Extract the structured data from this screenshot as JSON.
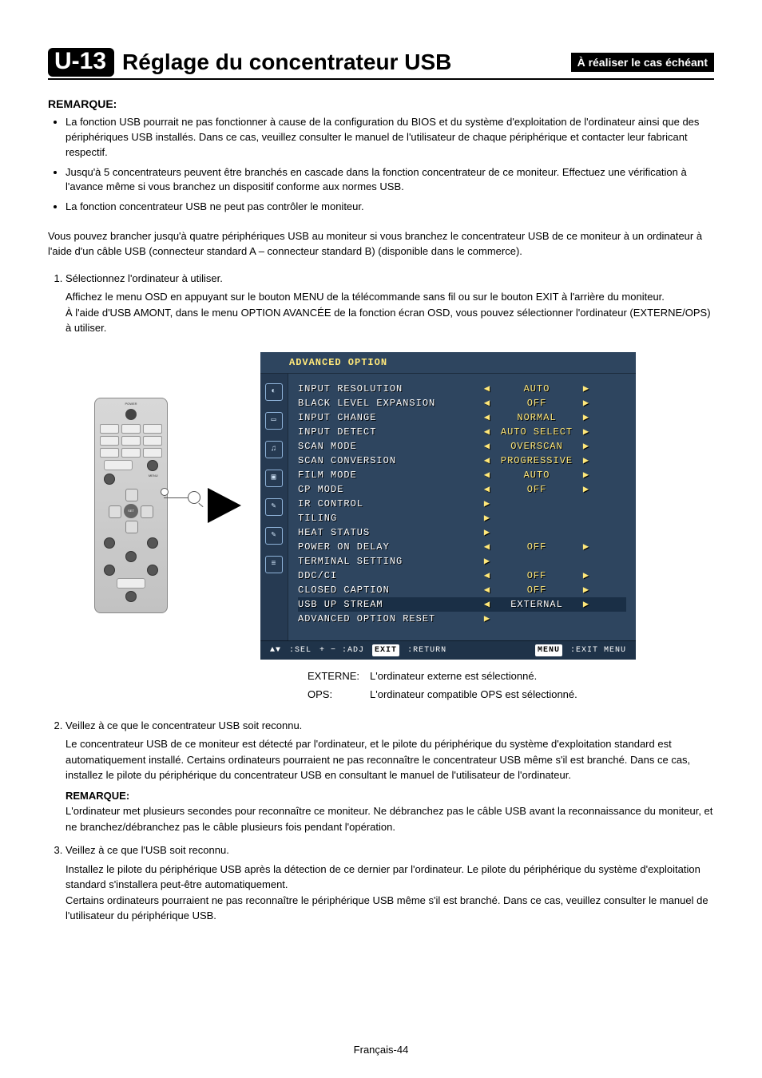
{
  "header": {
    "tag": "U-13",
    "title": "Réglage du concentrateur USB",
    "badge": "À réaliser le cas échéant"
  },
  "remarque_label": "REMARQUE:",
  "remarque_bullets": [
    "La fonction USB pourrait ne pas fonctionner à cause de la configuration du BIOS et du système d'exploitation de l'ordinateur ainsi que des périphériques USB installés. Dans ce cas, veuillez consulter le manuel de l'utilisateur de chaque périphérique et contacter leur fabricant respectif.",
    "Jusqu'à 5 concentrateurs peuvent être branchés en cascade dans la fonction concentrateur de ce moniteur. Effectuez une vérification à l'avance même si vous branchez un dispositif conforme aux normes USB.",
    "La fonction concentrateur USB ne peut pas contrôler le moniteur."
  ],
  "intro": "Vous pouvez brancher jusqu'à quatre périphériques USB au moniteur si vous branchez le concentrateur USB de ce moniteur à un ordinateur à l'aide d'un câble USB (connecteur standard A – connecteur standard B) (disponible dans le commerce).",
  "steps": {
    "s1": {
      "title": "Sélectionnez l'ordinateur à utiliser.",
      "p1": "Affichez le menu OSD en appuyant sur le bouton MENU de la télécommande sans fil ou sur le bouton EXIT à l'arrière du moniteur.",
      "p2": "À l'aide d'USB AMONT, dans le menu OPTION AVANCÉE de la fonction écran OSD, vous pouvez sélectionner l'ordinateur (EXTERNE/OPS) à utiliser."
    },
    "legend": {
      "k1": "EXTERNE:",
      "v1": "L'ordinateur externe est sélectionné.",
      "k2": "OPS:",
      "v2": "L'ordinateur compatible OPS est sélectionné."
    },
    "s2": {
      "title": "Veillez à ce que le concentrateur USB soit reconnu.",
      "p1": "Le concentrateur USB de ce moniteur est détecté par l'ordinateur, et le pilote du périphérique du système d'exploitation standard est automatiquement installé. Certains ordinateurs pourraient ne pas reconnaître le concentrateur USB même s'il est branché. Dans ce cas, installez le pilote du périphérique du concentrateur USB en consultant le manuel de l'utilisateur de l'ordinateur.",
      "note_label": "REMARQUE:",
      "note": "L'ordinateur met plusieurs secondes pour reconnaître ce moniteur. Ne débranchez pas le câble USB avant la reconnaissance du moniteur, et ne branchez/débranchez pas le câble plusieurs fois pendant l'opération."
    },
    "s3": {
      "title": "Veillez à ce que l'USB soit reconnu.",
      "p1": "Installez le pilote du périphérique USB après la détection de ce dernier par l'ordinateur. Le pilote du périphérique du système d'exploitation standard s'installera peut-être automatiquement.",
      "p2": "Certains ordinateurs pourraient ne pas reconnaître le périphérique USB même s'il est branché. Dans ce cas, veuillez consulter le manuel de l'utilisateur du périphérique USB."
    }
  },
  "remote": {
    "labels": {
      "power": "POWER",
      "set": "SET",
      "menu": "MENU"
    }
  },
  "osd": {
    "title": "ADVANCED OPTION",
    "rows": [
      {
        "label": "INPUT RESOLUTION",
        "value": "AUTO",
        "lr": true
      },
      {
        "label": "BLACK LEVEL EXPANSION",
        "value": "OFF",
        "lr": true
      },
      {
        "label": "INPUT CHANGE",
        "value": "NORMAL",
        "lr": true
      },
      {
        "label": "INPUT DETECT",
        "value": "AUTO SELECT",
        "lr": true
      },
      {
        "label": "SCAN MODE",
        "value": "OVERSCAN",
        "lr": true
      },
      {
        "label": "SCAN CONVERSION",
        "value": "PROGRESSIVE",
        "lr": true
      },
      {
        "label": "FILM MODE",
        "value": "AUTO",
        "lr": true
      },
      {
        "label": "CP MODE",
        "value": "OFF",
        "lr": true
      },
      {
        "label": "IR CONTROL",
        "value": "",
        "ronly": true
      },
      {
        "label": "TILING",
        "value": "",
        "ronly": true
      },
      {
        "label": "HEAT STATUS",
        "value": "",
        "ronly": true
      },
      {
        "label": "POWER ON DELAY",
        "value": "OFF",
        "lr": true
      },
      {
        "label": "TERMINAL SETTING",
        "value": "",
        "ronly": true
      },
      {
        "label": "DDC/CI",
        "value": "OFF",
        "lr": true
      },
      {
        "label": "CLOSED CAPTION",
        "value": "OFF",
        "lr": true
      },
      {
        "label": "USB UP STREAM",
        "value": "EXTERNAL",
        "lr": true,
        "hl": true
      },
      {
        "label": "ADVANCED OPTION RESET",
        "value": "",
        "ronly": true
      }
    ],
    "footer": {
      "sel": ":SEL",
      "adj": "+ − :ADJ",
      "exit_box": "EXIT",
      "return": ":RETURN",
      "menu_box": "MENU",
      "exitmenu": ":EXIT MENU"
    }
  },
  "page_footer": "Français-44"
}
